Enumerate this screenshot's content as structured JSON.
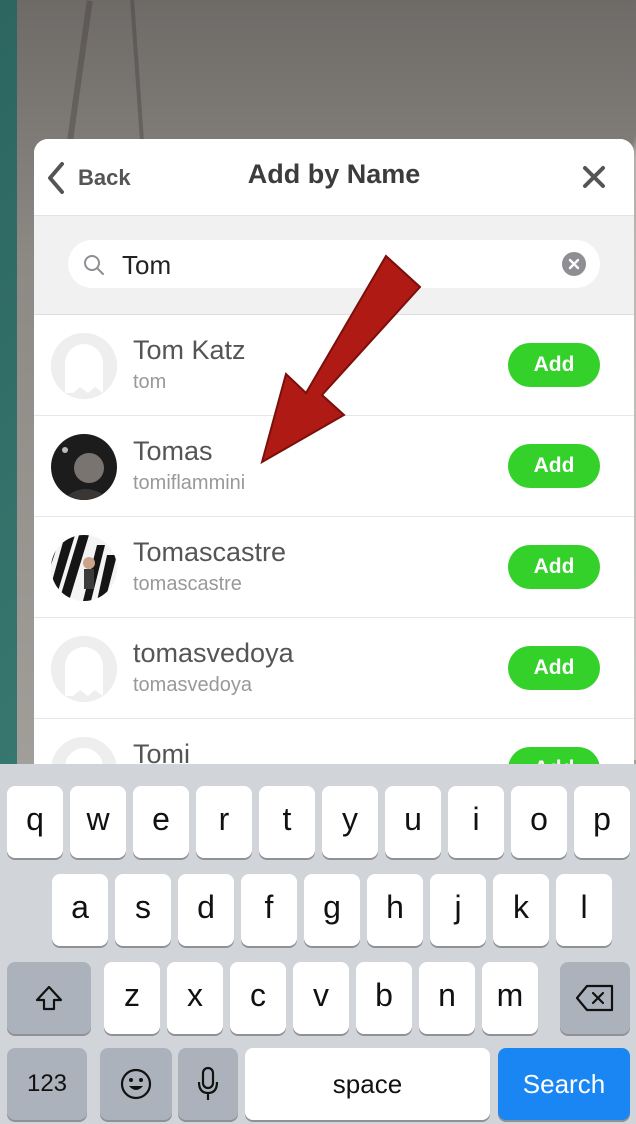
{
  "nav": {
    "back_label": "Back",
    "title": "Add by Name"
  },
  "search": {
    "value": "Tom"
  },
  "results": [
    {
      "name": "Tom Katz",
      "username": "tom",
      "avatar": "ghost-placeholder",
      "action": "Add"
    },
    {
      "name": "Tomas",
      "username": "tomiflammini",
      "avatar": "photo-dark",
      "action": "Add"
    },
    {
      "name": "Tomascastre",
      "username": "tomascastre",
      "avatar": "photo-stripes",
      "action": "Add"
    },
    {
      "name": "tomasvedoya",
      "username": "tomasvedoya",
      "avatar": "ghost-placeholder",
      "action": "Add"
    },
    {
      "name": "Tomi",
      "username": "",
      "avatar": "ghost-placeholder",
      "action": "Add"
    }
  ],
  "annotation": {
    "arrow_color": "#b01a14",
    "points_to": "Tomas"
  },
  "colors": {
    "add_button": "#34d12a",
    "search_key": "#1a86f4"
  },
  "keyboard": {
    "row1": [
      "q",
      "w",
      "e",
      "r",
      "t",
      "y",
      "u",
      "i",
      "o",
      "p"
    ],
    "row2": [
      "a",
      "s",
      "d",
      "f",
      "g",
      "h",
      "j",
      "k",
      "l"
    ],
    "row3": [
      "z",
      "x",
      "c",
      "v",
      "b",
      "n",
      "m"
    ],
    "numbers_label": "123",
    "space_label": "space",
    "search_label": "Search"
  }
}
